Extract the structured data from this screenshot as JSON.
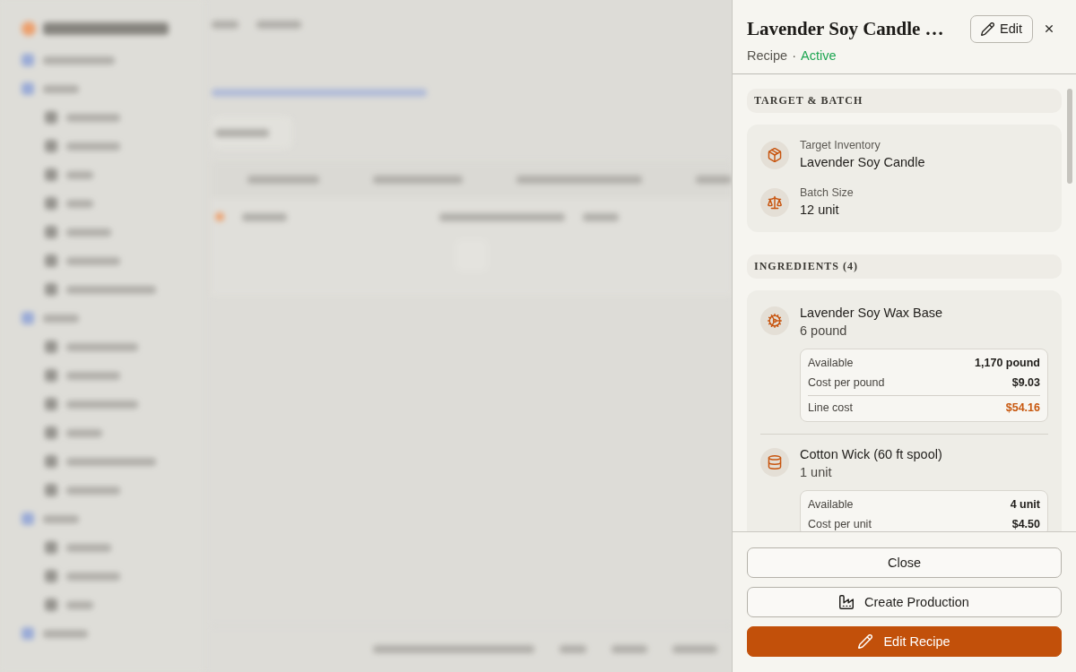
{
  "panel": {
    "title": "Lavender Soy Candle …",
    "edit_button": "Edit",
    "subtitle": {
      "type": "Recipe",
      "separator": "·",
      "status": "Active"
    },
    "sections": [
      {
        "kind": "fields",
        "heading": "TARGET & BATCH",
        "fields": [
          {
            "label": "Target Inventory",
            "value": "Lavender Soy Candle"
          },
          {
            "label": "Batch Size",
            "value": "12 unit"
          }
        ]
      },
      {
        "kind": "ingredients",
        "heading": "INGREDIENTS (4)",
        "items": [
          {
            "name": "Lavender Soy Wax Base",
            "quantity": "6 pound",
            "stats": [
              {
                "label": "Available",
                "value": "1,170 pound",
                "kind": "plain"
              },
              {
                "label": "Cost per pound",
                "value": "$9.03",
                "kind": "plain"
              },
              {
                "label": "Line cost",
                "value": "$54.16",
                "kind": "total"
              }
            ]
          },
          {
            "name": "Cotton Wick (60 ft spool)",
            "quantity": "1 unit",
            "stats": [
              {
                "label": "Available",
                "value": "4 unit",
                "kind": "plain"
              },
              {
                "label": "Cost per unit",
                "value": "$4.50",
                "kind": "plain"
              }
            ]
          }
        ]
      }
    ]
  },
  "footer_buttons": [
    {
      "label": "Close",
      "kind": "outline"
    },
    {
      "label": "Create Production",
      "kind": "outline"
    },
    {
      "label": "Edit Recipe",
      "kind": "primary"
    }
  ]
}
